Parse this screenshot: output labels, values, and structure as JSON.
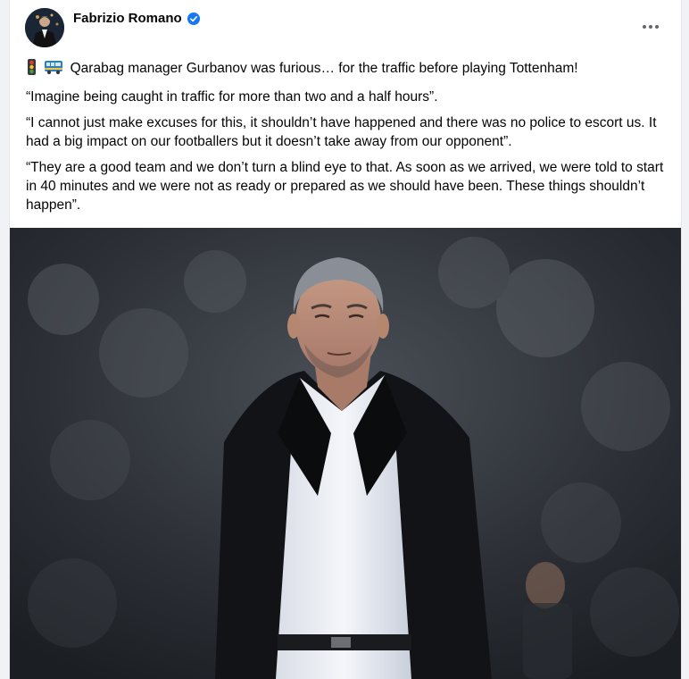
{
  "post": {
    "author": {
      "name": "Fabrizio Romano",
      "verified": true,
      "verified_color": "#1877f2"
    },
    "menu_icon": "more-horizontal-icon",
    "emojis": [
      "traffic-light-icon",
      "bus-icon"
    ],
    "headline": "Qarabag manager Gurbanov was furious… for the traffic before playing Tottenham!",
    "paragraphs": [
      "“Imagine being caught in traffic for more than two and a half hours”.",
      "“I cannot just make excuses for this, it shouldn’t have happened and there was no police to escort us. It had a big impact on our footballers but it doesn’t take away from our opponent”.",
      "“They are a good team and we don’t turn a blind eye to that. As soon as we arrived, we were told to start in 40 minutes and we were not as ready or prepared as we should have been. These things shouldn’t happen”."
    ]
  }
}
